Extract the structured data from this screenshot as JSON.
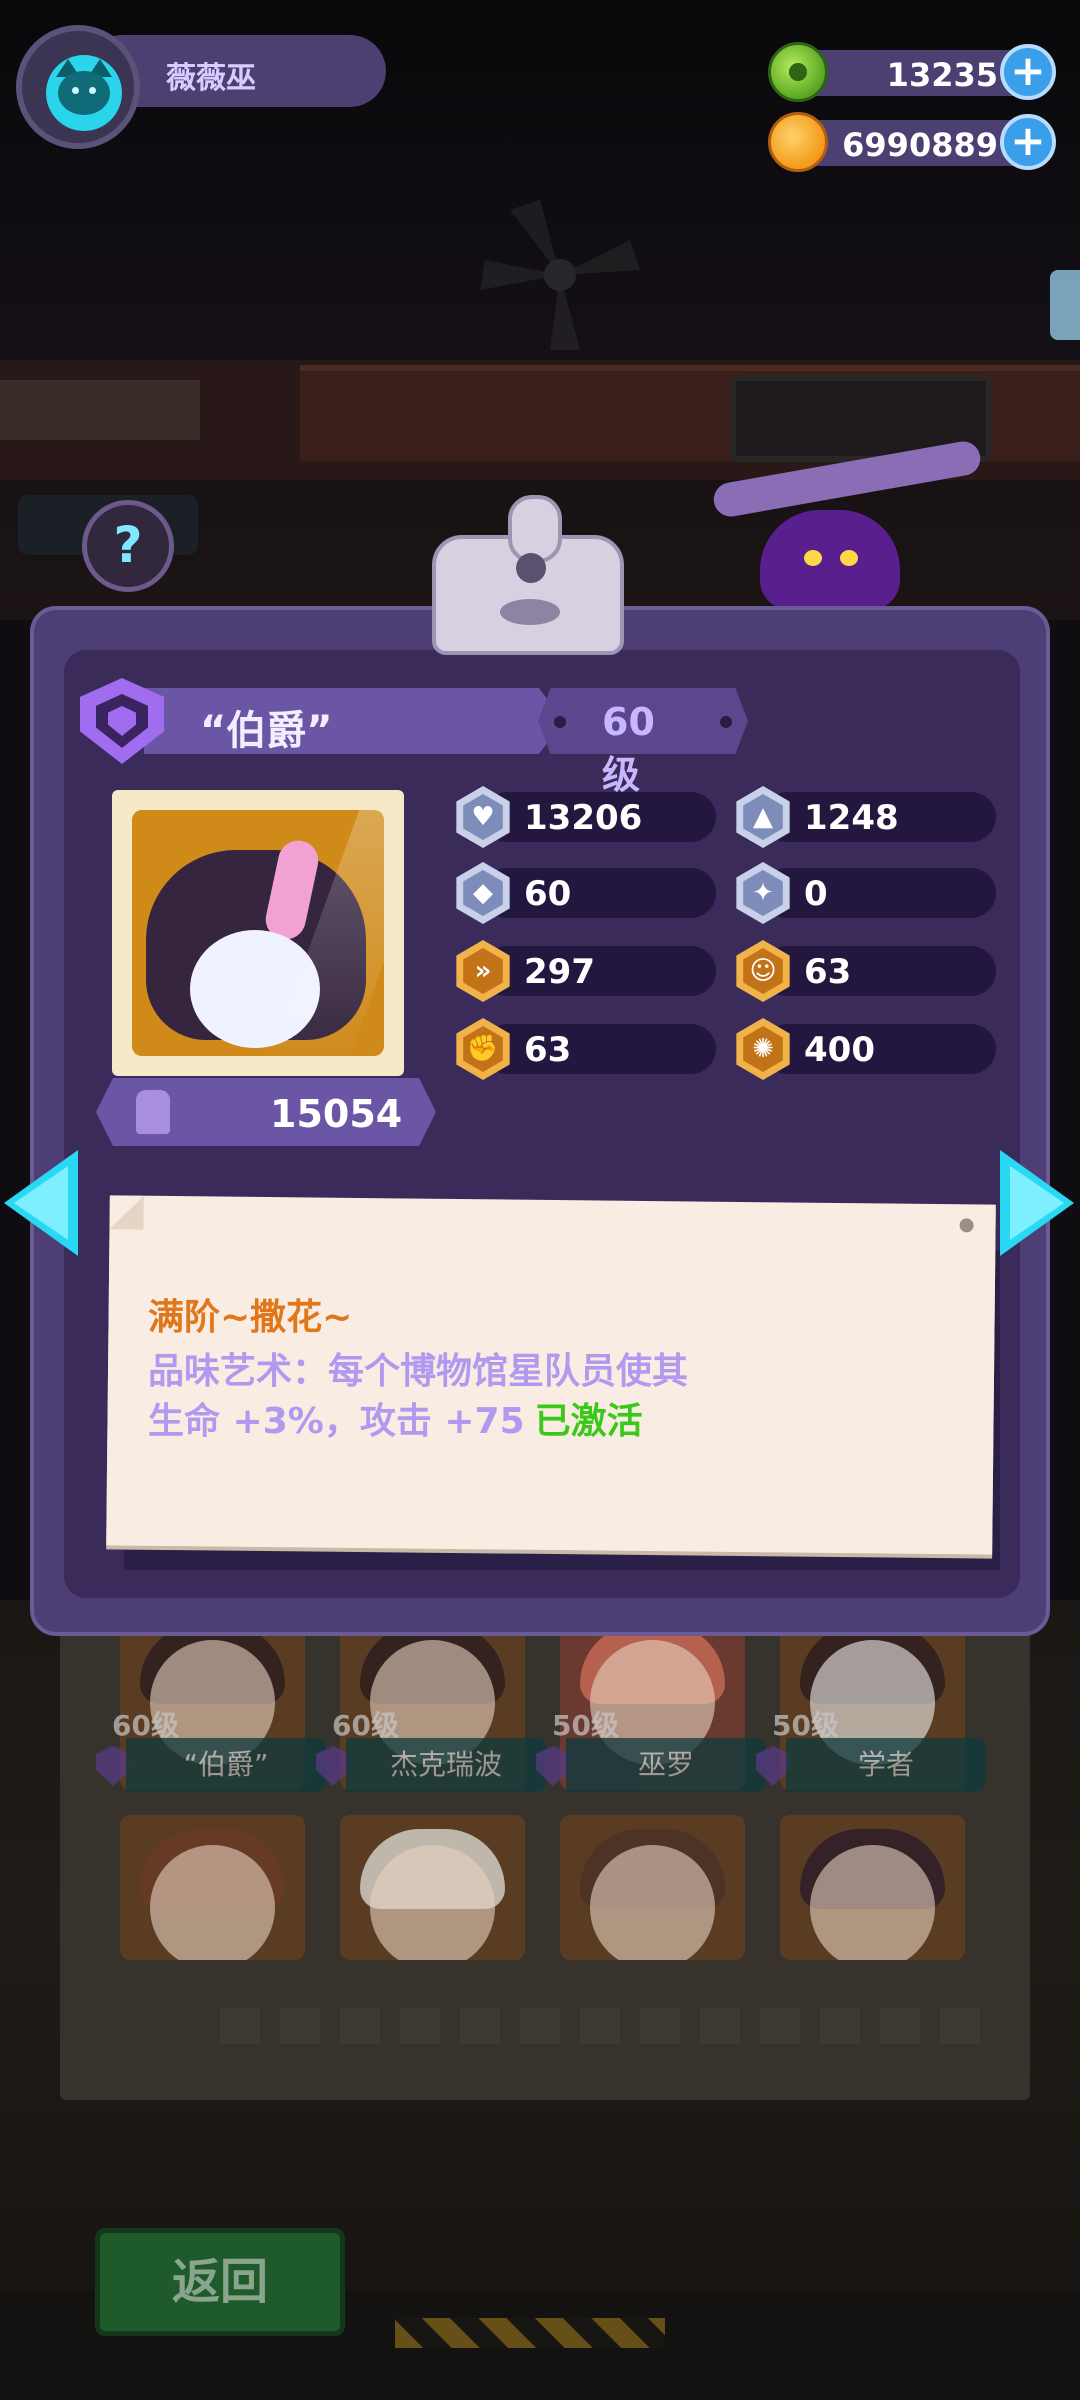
{
  "player": {
    "name": "薇薇巫"
  },
  "currencies": [
    {
      "id": "green",
      "value": "13235"
    },
    {
      "id": "orange",
      "value": "6990889"
    }
  ],
  "help_glyph": "?",
  "character": {
    "title": "“伯爵”",
    "level": "60级",
    "power": "15054",
    "stats": [
      {
        "icon": "health-icon",
        "value": "13206"
      },
      {
        "icon": "attack-icon",
        "value": "1248"
      },
      {
        "icon": "defense-icon",
        "value": "60"
      },
      {
        "icon": "pierce-icon",
        "value": "0"
      },
      {
        "icon": "speed-icon",
        "value": "297"
      },
      {
        "icon": "charm-icon",
        "value": "63"
      },
      {
        "icon": "strength-icon",
        "value": "63"
      },
      {
        "icon": "brain-icon",
        "value": "400"
      }
    ],
    "bonus": {
      "title": "满阶~撒花~",
      "line1": "品味艺术：每个博物馆星队员使其",
      "line2": "生命 +3%，攻击 +75",
      "status": "已激活"
    }
  },
  "roster": [
    {
      "level": "60级",
      "name": "“伯爵”"
    },
    {
      "level": "60级",
      "name": "杰克瑞波"
    },
    {
      "level": "50级",
      "name": "巫罗"
    },
    {
      "level": "50级",
      "name": "学者"
    }
  ],
  "back_label": "返回",
  "colors": {
    "panel": "#4e3e76",
    "accent_cyan": "#29d8f2",
    "active_green": "#3cc81a",
    "note_title_orange": "#e2761a"
  }
}
